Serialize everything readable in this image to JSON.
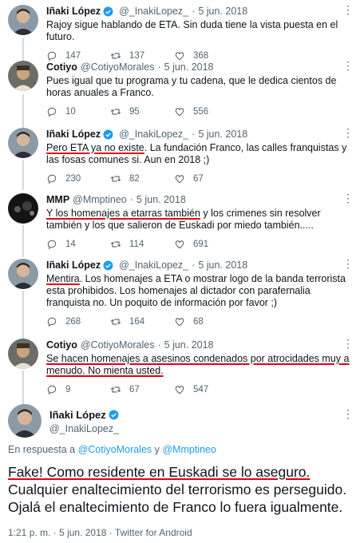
{
  "tweets": [
    {
      "name": "Iñaki López",
      "verified": true,
      "handle": "@_InakiLopez_",
      "date": "5 jun. 2018",
      "text_segments": [
        {
          "text": "Rajoy sigue hablando de ETA. Sin duda tiene la vista puesta en el futuro.",
          "underline": false
        }
      ],
      "replies": "147",
      "retweets": "137",
      "likes": "368"
    },
    {
      "name": "Cotiyo",
      "verified": false,
      "handle": "@CotiyoMorales",
      "date": "5 jun. 2018",
      "text_segments": [
        {
          "text": "Pues igual que tu programa y tu cadena, que le dedica cientos de horas anuales a Franco.",
          "underline": false
        }
      ],
      "replies": "10",
      "retweets": "95",
      "likes": "556"
    },
    {
      "name": "Iñaki López",
      "verified": true,
      "handle": "@_InakiLopez_",
      "date": "5 jun. 2018",
      "text_segments": [
        {
          "text": "Pero ETA ya no existe",
          "underline": true
        },
        {
          "text": ". La fundación Franco, las calles franquistas y las fosas comunes si. Aun en 2018 ;)",
          "underline": false
        }
      ],
      "replies": "230",
      "retweets": "82",
      "likes": "67"
    },
    {
      "name": "MMP",
      "verified": false,
      "handle": "@Mmptineo",
      "date": "5 jun. 2018",
      "text_segments": [
        {
          "text": "Y los homenajes a etarras también",
          "underline": true
        },
        {
          "text": " y los crimenes sin resolver también y los que salieron de Euskadi por miedo también.....",
          "underline": false
        }
      ],
      "replies": "14",
      "retweets": "114",
      "likes": "691"
    },
    {
      "name": "Iñaki López",
      "verified": true,
      "handle": "@_InakiLopez_",
      "date": "5 jun. 2018",
      "text_segments": [
        {
          "text": "Mentira",
          "underline": true
        },
        {
          "text": ". Los homenajes a ETA o mostrar logo de la banda terrorista esta prohibidos. Los homenajes al dictador con parafernalia franquista no. Un poquito de información por favor ;)",
          "underline": false
        }
      ],
      "replies": "268",
      "retweets": "164",
      "likes": "68"
    },
    {
      "name": "Cotiyo",
      "verified": false,
      "handle": "@CotiyoMorales",
      "date": "5 jun. 2018",
      "text_segments": [
        {
          "text": "Se hacen homenajes a asesinos condenados por atrocidades muy a menudo. No mienta usted.",
          "underline": true
        }
      ],
      "replies": "9",
      "retweets": "67",
      "likes": "547"
    }
  ],
  "main_tweet": {
    "name": "Iñaki López",
    "verified": true,
    "handle": "@_InakiLopez_",
    "reply_prefix": "En respuesta a",
    "reply_user1": "@CotiyoMorales",
    "reply_conj": "y",
    "reply_user2": "@Mmptineo",
    "text_underlined": "Fake! Como residente en Euskadi se lo aseguro.",
    "text_rest": " Cualquier enaltecimiento del terrorismo es perseguido. Ojalá el enaltecimiento de Franco lo fuera igualmente.",
    "time": "1:21 p. m.",
    "date": "5 jun. 2018",
    "source": "Twitter for Android"
  },
  "colors": {
    "accent": "#1d9bf0",
    "underline": "#e0001b",
    "secondary_text": "#536471"
  },
  "icons": {
    "reply": "reply-icon",
    "retweet": "retweet-icon",
    "like": "like-icon",
    "verified": "verified-badge-icon",
    "more": "more-options-icon"
  }
}
